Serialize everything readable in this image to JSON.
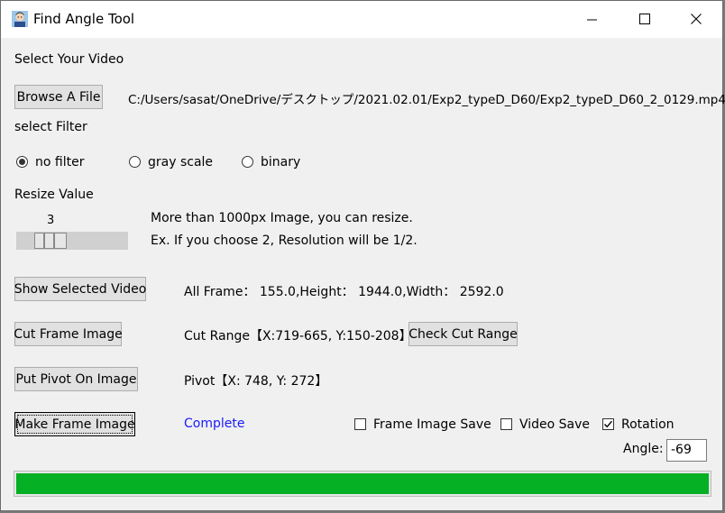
{
  "window": {
    "title": "Find Angle Tool"
  },
  "video": {
    "section_label": "Select Your Video",
    "browse_label": "Browse A File",
    "file_path": "C:/Users/sasat/OneDrive/デスクトップ/2021.02.01/Exp2_typeD_D60/Exp2_typeD_D60_2_0129.mp4"
  },
  "filter": {
    "section_label": "select Filter",
    "options": [
      "no filter",
      "gray scale",
      "binary"
    ],
    "selected": "no filter"
  },
  "resize": {
    "section_label": "Resize Value",
    "value": "3",
    "slider_fraction": 0.29,
    "help_line1": "More than 1000px Image, you can resize.",
    "help_line2": "Ex. If you choose 2, Resolution will be 1/2."
  },
  "show_video": {
    "button_label": "Show Selected Video",
    "info": "All Frame： 155.0,Height： 1944.0,Width： 2592.0"
  },
  "cut": {
    "button_label": "Cut Frame Image",
    "range_text": "Cut Range【X:719-665, Y:150-208】",
    "check_label": "Check Cut Range"
  },
  "pivot": {
    "button_label": "Put Pivot On Image",
    "text": "Pivot【X: 748, Y: 272】"
  },
  "make": {
    "button_label": "Make Frame Image",
    "status": "Complete",
    "status_color": "#1a1aff",
    "frame_save_label": "Frame Image Save",
    "frame_save_checked": false,
    "video_save_label": "Video Save",
    "video_save_checked": false,
    "rotation_label": "Rotation",
    "rotation_checked": true,
    "angle_label": "Angle:",
    "angle_value": "-69"
  },
  "progress": {
    "percent": 100,
    "color": "#06b025"
  }
}
